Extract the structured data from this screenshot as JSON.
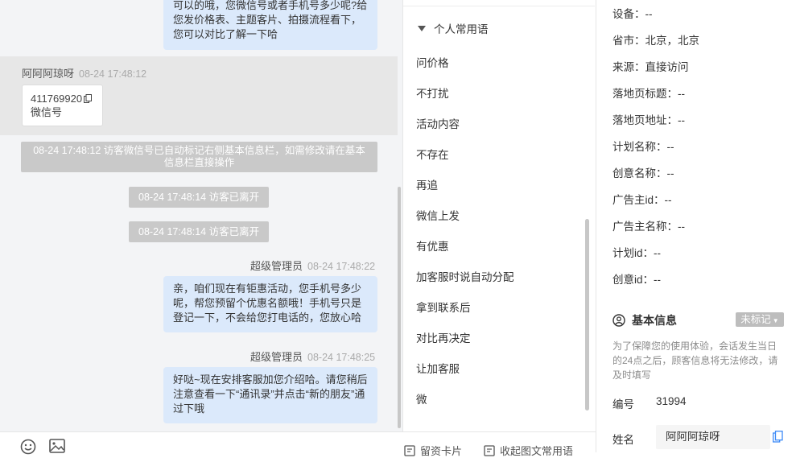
{
  "chat": {
    "top_message": "可以的哦，您微信号或者手机号多少呢?给您发价格表、主题客片、拍摄流程看下，您可以对比了解一下哈",
    "visitor": {
      "name": "阿阿阿琼呀",
      "time": "08-24 17:48:12"
    },
    "wechat_card": {
      "number": "411769920",
      "label": "微信号"
    },
    "system_notice": "08-24 17:48:12 访客微信号已自动标记右侧基本信息栏，如需修改请在基本信息栏直接操作",
    "left_notices": [
      "08-24 17:48:14 访客已离开",
      "08-24 17:48:14 访客已离开"
    ],
    "agent_messages": [
      {
        "sender": "超级管理员",
        "time": "08-24 17:48:22",
        "text": "亲，咱们现在有钜惠活动，您手机号多少呢，帮您预留个优惠名额哦！手机号只是登记一下，不会给您打电话的，您放心哈"
      },
      {
        "sender": "超级管理员",
        "time": "08-24 17:48:25",
        "text": "好哒~现在安排客服加您介绍哈。请您稍后注意查看一下“通讯录”并点击“新的朋友”通过下哦"
      }
    ]
  },
  "footer": {
    "card_label": "留资卡片",
    "collapse_label": "收起图文常用语"
  },
  "phrases": {
    "header": "个人常用语",
    "items": [
      "问价格",
      "不打扰",
      "活动内容",
      "不存在",
      "再追",
      "微信上发",
      "有优惠",
      "加客服时说自动分配",
      "拿到联系后",
      "对比再决定",
      "让加客服",
      "微"
    ]
  },
  "info": {
    "rows": [
      "设备：--",
      "省市：北京，北京",
      "来源：直接访问",
      "落地页标题：--",
      "落地页地址：--",
      "计划名称：--",
      "创意名称：--",
      "广告主id：--",
      "广告主名称：--",
      "计划id：--",
      "创意id：--"
    ],
    "section_title": "基本信息",
    "tag_label": "未标记",
    "notice": "为了保障您的使用体验，会话发生当日的24点之后，顾客信息将无法修改，请及时填写",
    "id_label": "编号",
    "id_value": "31994",
    "name_label": "姓名",
    "name_value": "阿阿阿琼呀"
  },
  "colors": {
    "bubble": "#dbe9fb",
    "accent": "#3d8af7",
    "system": "#c9c9c9"
  }
}
